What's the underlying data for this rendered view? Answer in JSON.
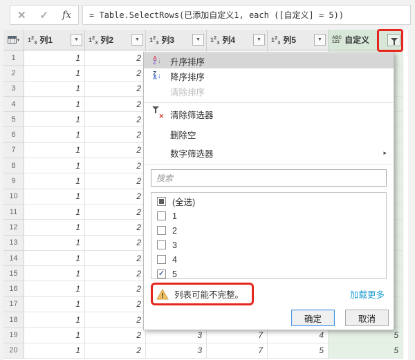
{
  "colors": {
    "annot_red": "#e5271d",
    "link_blue": "#1d9dd0",
    "selected_column_green": "#d8e8d8"
  },
  "formula_bar": {
    "cancel_glyph": "✕",
    "confirm_glyph": "✓",
    "fx_glyph": "fx",
    "formula": "= Table.SelectRows(已添加自定义1, each ([自定义] = 5))"
  },
  "grid": {
    "columns": [
      {
        "type": "123",
        "label": "列1",
        "selected": false
      },
      {
        "type": "123",
        "label": "列2",
        "selected": false
      },
      {
        "type": "123",
        "label": "列3",
        "selected": false
      },
      {
        "type": "123",
        "label": "列4",
        "selected": false
      },
      {
        "type": "123",
        "label": "列5",
        "selected": false
      },
      {
        "type": "abc123",
        "label": "自定义",
        "selected": true,
        "filtered": true
      }
    ],
    "rows": [
      {
        "n": "1",
        "cells": [
          "1",
          "2",
          "",
          "",
          "",
          ""
        ]
      },
      {
        "n": "2",
        "cells": [
          "1",
          "2",
          "",
          "",
          "",
          ""
        ]
      },
      {
        "n": "3",
        "cells": [
          "1",
          "2",
          "",
          "",
          "",
          ""
        ]
      },
      {
        "n": "4",
        "cells": [
          "1",
          "2",
          "",
          "",
          "",
          ""
        ]
      },
      {
        "n": "5",
        "cells": [
          "1",
          "2",
          "",
          "",
          "",
          ""
        ]
      },
      {
        "n": "6",
        "cells": [
          "1",
          "2",
          "",
          "",
          "",
          ""
        ]
      },
      {
        "n": "7",
        "cells": [
          "1",
          "2",
          "",
          "",
          "",
          ""
        ]
      },
      {
        "n": "8",
        "cells": [
          "1",
          "2",
          "",
          "",
          "",
          ""
        ]
      },
      {
        "n": "9",
        "cells": [
          "1",
          "2",
          "",
          "",
          "",
          ""
        ]
      },
      {
        "n": "10",
        "cells": [
          "1",
          "2",
          "",
          "",
          "",
          ""
        ]
      },
      {
        "n": "11",
        "cells": [
          "1",
          "2",
          "",
          "",
          "",
          ""
        ]
      },
      {
        "n": "12",
        "cells": [
          "1",
          "2",
          "",
          "",
          "",
          ""
        ]
      },
      {
        "n": "13",
        "cells": [
          "1",
          "2",
          "",
          "",
          "",
          ""
        ]
      },
      {
        "n": "14",
        "cells": [
          "1",
          "2",
          "",
          "",
          "",
          ""
        ]
      },
      {
        "n": "15",
        "cells": [
          "1",
          "2",
          "",
          "",
          "",
          ""
        ]
      },
      {
        "n": "16",
        "cells": [
          "1",
          "2",
          "",
          "",
          "",
          ""
        ]
      },
      {
        "n": "17",
        "cells": [
          "1",
          "2",
          "",
          "",
          "",
          ""
        ]
      },
      {
        "n": "18",
        "cells": [
          "1",
          "2",
          "",
          "",
          "",
          ""
        ]
      },
      {
        "n": "19",
        "cells": [
          "1",
          "2",
          "3",
          "7",
          "4",
          "5"
        ]
      },
      {
        "n": "20",
        "cells": [
          "1",
          "2",
          "3",
          "7",
          "5",
          "5"
        ]
      }
    ]
  },
  "filter_menu": {
    "items": [
      {
        "label": "升序排序"
      },
      {
        "label": "降序排序"
      },
      {
        "label": "清除排序"
      },
      {
        "label": "清除筛选器"
      },
      {
        "label": "删除空"
      },
      {
        "label": "数字筛选器"
      }
    ],
    "submenu_arrow": "▸",
    "search_placeholder": "搜索",
    "checklist": [
      {
        "label": "(全选)",
        "state": "indeterminate"
      },
      {
        "label": "1",
        "state": "unchecked"
      },
      {
        "label": "2",
        "state": "unchecked"
      },
      {
        "label": "3",
        "state": "unchecked"
      },
      {
        "label": "4",
        "state": "unchecked"
      },
      {
        "label": "5",
        "state": "checked"
      }
    ],
    "warning_text": "列表可能不完整。",
    "load_more_label": "加载更多",
    "ok_label": "确定",
    "cancel_label": "取消"
  }
}
